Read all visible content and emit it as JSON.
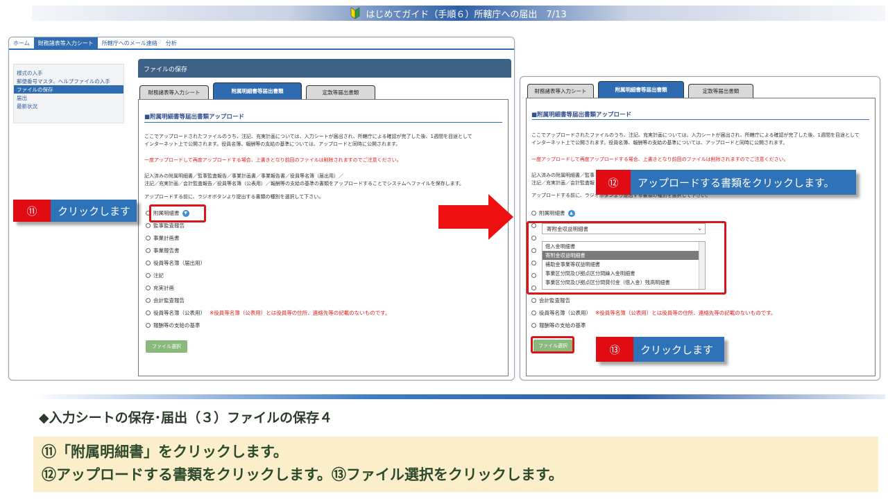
{
  "title_bar": {
    "text": "はじめてガイド（手順６）所轄庁への届出　7/13"
  },
  "left_panel": {
    "nav": [
      "ホーム",
      "財務諸表等入力シート",
      "所轄庁へのメール連絡",
      "分析"
    ],
    "sidebar": [
      "様式の入手",
      "郵便番号マスタ、ヘルプファイルの入手",
      "ファイルの保存",
      "届出",
      "最新状況"
    ],
    "section_header": "ファイルの保存",
    "tabs": [
      "財務諸表等入力シート",
      "附属明細書等届出書類",
      "定款等届出書類"
    ],
    "sub_title": "■附属明細書等届出書類アップロード",
    "para1": "ここでアップロードされたファイルのうち、注記、充実計画については、入力シートが届出され、所轄庁による確認が完了した後、1週間を目途として",
    "para2": "インターネット上で公開されます。役員名簿、報酬等の支給の基準については、アップロードと同時に公開されます。",
    "warning": "一度アップロードして再度アップロードする場合、上書きとなり前回のファイルは削除されますのでご注意ください。",
    "para3": "記入済みの附属明細書／監事監査報告／事業計画書／事業報告書／役員等名簿（届出用）／",
    "para4": "注記／充実計画／会計監査報告／役員等名簿（公表用）／報酬等の支給の基準の書類をアップロードすることでシステムへファイルを保存します。",
    "para5": "アップロードする前に、ラジオボタンより提出する書類の種別を選択して下さい。",
    "radios": [
      "附属明細書",
      "監事監査報告",
      "事業計画書",
      "事業報告書",
      "役員等名簿（届出用）",
      "注記",
      "充実計画",
      "会計監査報告",
      "役員等名簿（公表用）",
      "報酬等の支給の基準"
    ],
    "radio_note": "※役員等名簿（公表用）とは役員等の住所、連絡先等の記載のないものです。",
    "file_button": "ファイル選択"
  },
  "right_panel": {
    "tabs": [
      "財務諸表等入力シート",
      "附属明細書等届出書類",
      "定款等届出書類"
    ],
    "sub_title": "■附属明細書等届出書類アップロード",
    "para1": "ここでアップロードされたファイルのうち、注記、充実計画については、入力シートが届出され、所轄庁による確認が完了した後、1週間を目途として",
    "para2": "インターネット上で公開されます。役員名簿、報酬等の支給の基準については、アップロードと同時に公開されます。",
    "warning": "一度アップロードして再度アップロードする場合、上書きとなり前回のファイルは削除されますのでご注意ください。",
    "para3": "記入済みの附属明細書／監事",
    "para4": "注記／充実計画／会計監査報",
    "para5": "アップロードする前に、ラジオボタンより提出する書類の種別を選択して下さい。",
    "radio_first": "附属明細書",
    "select_value": "寄附金収益明細書",
    "list_items": [
      "借入金明細書",
      "寄附金収益明細書",
      "補助金事業等収益明細書",
      "事業区分間及び拠点区分間繰入金明細書",
      "事業区分間及び拠点区分間貸付金（借入金）残高明細書"
    ],
    "radios_after": [
      "会計監査報告",
      "役員等名簿（公表用）",
      "報酬等の支給の基準"
    ],
    "radio_note": "※役員等名簿（公表用）とは役員等の住所、連絡先等の記載のないものです。",
    "file_button": "ファイル選択"
  },
  "callouts": {
    "c11": {
      "num": "⑪",
      "text": "クリックします"
    },
    "c12": {
      "num": "⑫",
      "text": "アップロードする書類をクリックします。"
    },
    "c13": {
      "num": "⑬",
      "text": "クリックします"
    }
  },
  "bottom": {
    "heading": "◆入力シートの保存･届出（３）ファイルの保存４",
    "line1": "⑪「附属明細書」をクリックします。",
    "line2": "⑫アップロードする書類をクリックします。⑬ファイル選択をクリックします。"
  },
  "colors": {
    "accent_blue": "#2e72b8",
    "callout_red": "#e00b13",
    "highlight_red": "#d9141b",
    "note_bg": "#fbeecb"
  }
}
